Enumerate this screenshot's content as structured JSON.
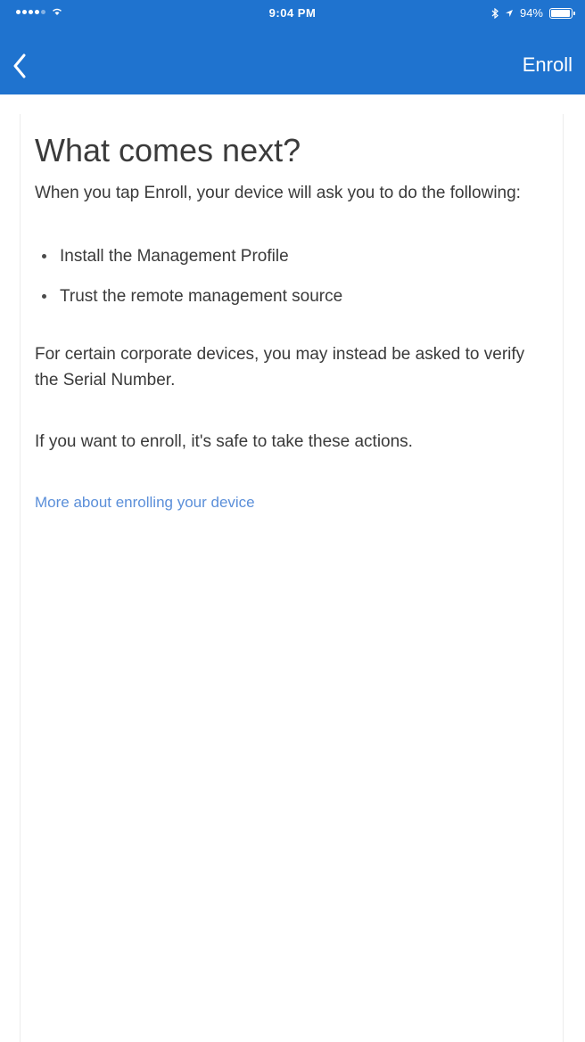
{
  "status_bar": {
    "time": "9:04 PM",
    "battery": "94%"
  },
  "nav": {
    "back_icon": "chevron-left-icon",
    "enroll_label": "Enroll"
  },
  "content": {
    "title": "What comes next?",
    "intro": "When you tap Enroll, your device will ask you to do the following:",
    "bullets": [
      "Install the Management Profile",
      "Trust the remote management source"
    ],
    "serial_note": "For certain corporate devices, you may instead be asked to verify the Serial Number.",
    "safe_note": "If you want to enroll, it's safe to take these actions.",
    "link_text": "More about enrolling your device"
  },
  "colors": {
    "header_blue": "#1f73cf",
    "link_blue": "#5b8fd9",
    "text": "#3a3a3a"
  }
}
